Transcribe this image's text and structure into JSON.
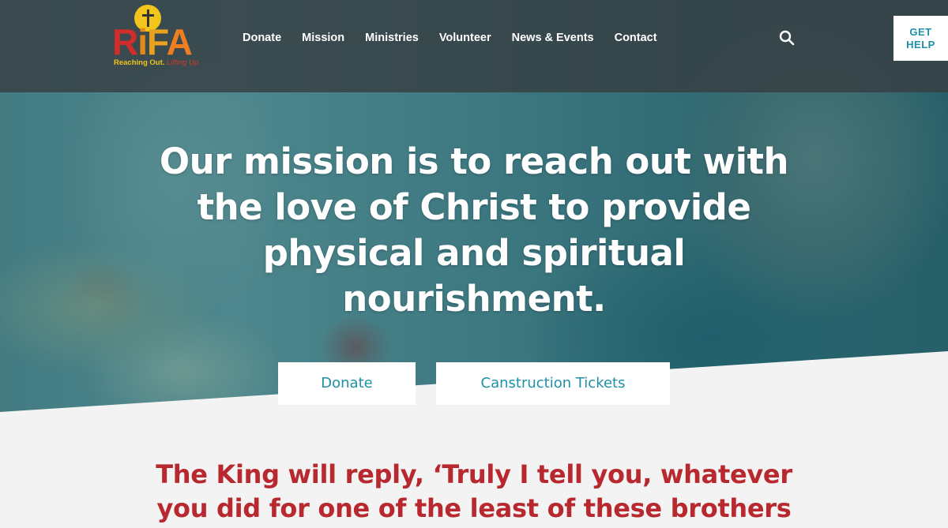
{
  "logo": {
    "letters": [
      "R",
      "i",
      "F",
      "A"
    ],
    "tagline_main": "Reaching Out.",
    "tagline_accent": "Lifting Up",
    "icon": "sun-cross-icon"
  },
  "nav": {
    "items": [
      "Donate",
      "Mission",
      "Ministries",
      "Volunteer",
      "News & Events",
      "Contact"
    ],
    "search_icon": "search-icon"
  },
  "get_help": {
    "line1": "GET",
    "line2": "HELP"
  },
  "hero": {
    "mission": "Our mission is to reach out with the love of Christ to provide physical and spiritual nourishment.",
    "buttons": {
      "donate": "Donate",
      "tickets": "Canstruction Tickets"
    }
  },
  "verse": {
    "text": "The King will reply, ‘Truly I tell you, whatever you did for one of the least of these brothers"
  },
  "colors": {
    "accent_teal": "#1e8fa8",
    "verse_red": "#b8292f",
    "logo_yellow": "#f2c51c",
    "logo_red": "#d12d2a",
    "logo_orange": "#ef7d21"
  }
}
